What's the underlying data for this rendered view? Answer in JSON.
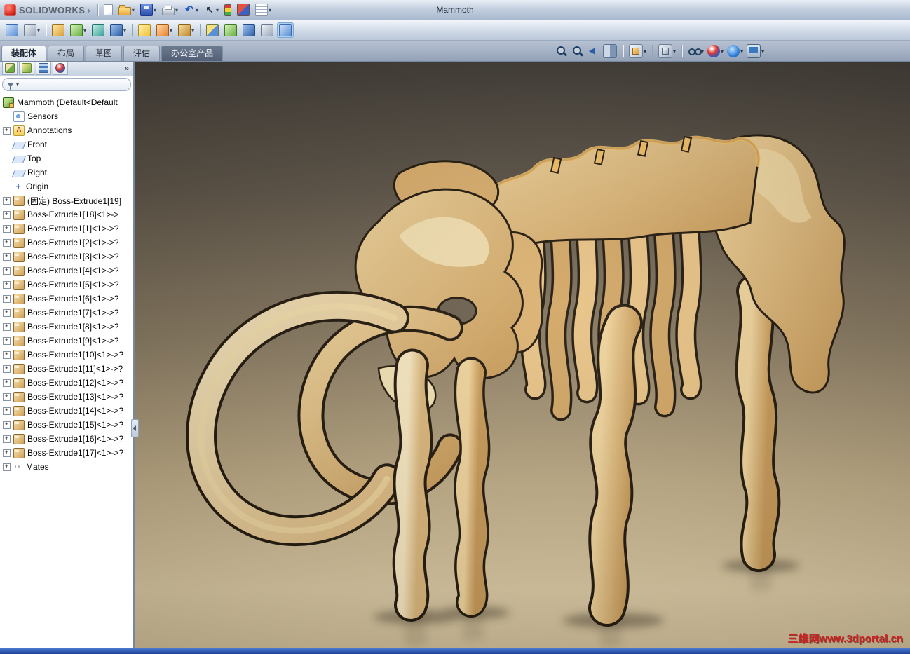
{
  "titlebar": {
    "app_name": "SOLIDWORKS",
    "title": "Mammoth",
    "menu_glyph": "›"
  },
  "toolbar_standard": {
    "items": [
      {
        "name": "new-document",
        "cls": "mi-new"
      },
      {
        "name": "open",
        "cls": "mi-open",
        "dd": true
      },
      {
        "name": "save",
        "cls": "mi-save",
        "dd": true
      },
      {
        "name": "print",
        "cls": "mi-print",
        "dd": true
      },
      {
        "name": "undo",
        "cls": "mi-undo",
        "glyph": "↶",
        "dd": true
      },
      {
        "name": "select",
        "cls": "mi-select",
        "glyph": "↖",
        "dd": true
      },
      {
        "name": "rebuild-stoplight",
        "cls": "mi-traffic"
      },
      {
        "name": "color-swatch",
        "cls": "mi-swatch"
      },
      {
        "name": "options",
        "cls": "mi-lines",
        "dd": true
      }
    ]
  },
  "toolbar_assembly": {
    "items": [
      {
        "name": "insert-components",
        "cls": "g-blue"
      },
      {
        "name": "mate",
        "cls": "g-gray",
        "dd": true
      },
      {
        "sep": true
      },
      {
        "name": "attachment",
        "cls": "g-gold"
      },
      {
        "name": "linear-component-pattern",
        "cls": "g-green",
        "dd": true
      },
      {
        "name": "smart-fasteners",
        "cls": "g-teal"
      },
      {
        "name": "move-component",
        "cls": "g-blue2",
        "dd": true
      },
      {
        "sep": true
      },
      {
        "name": "show-hidden-components",
        "cls": "g-yellow"
      },
      {
        "name": "assembly-features",
        "cls": "g-orange",
        "dd": true
      },
      {
        "name": "reference-geometry",
        "cls": "g-gold2",
        "dd": true
      },
      {
        "sep": true
      },
      {
        "name": "bill-of-materials",
        "cls": "g-mix"
      },
      {
        "name": "exploded-view",
        "cls": "g-green"
      },
      {
        "name": "explode-line-sketch",
        "cls": "g-blue2"
      },
      {
        "name": "interference-detection",
        "cls": "g-gray"
      },
      {
        "name": "large-assembly-mode",
        "cls": "g-blue",
        "pressed": true
      }
    ]
  },
  "tabs": {
    "items": [
      {
        "label": "装配体",
        "state": "active"
      },
      {
        "label": "布局",
        "state": "normal"
      },
      {
        "label": "草图",
        "state": "normal"
      },
      {
        "label": "评估",
        "state": "normal"
      },
      {
        "label": "办公室产品",
        "state": "dark"
      }
    ]
  },
  "headsup": {
    "items": [
      {
        "name": "zoom-to-fit",
        "cls": "hu-mag"
      },
      {
        "name": "zoom-to-area",
        "cls": "hu-mag2"
      },
      {
        "name": "previous-view",
        "cls": "hu-prev"
      },
      {
        "name": "section-view",
        "cls": "hu-sect"
      },
      {
        "sep": true
      },
      {
        "name": "view-orientation",
        "cls": "hu-cube",
        "dd": true
      },
      {
        "sep": true
      },
      {
        "name": "display-style",
        "cls": "hu-style",
        "dd": true
      },
      {
        "sep": true
      },
      {
        "name": "hide-show-items",
        "cls": "hu-eye",
        "dd": true
      },
      {
        "name": "edit-appearance",
        "cls": "hu-ball",
        "dd": true
      },
      {
        "name": "apply-scene",
        "cls": "hu-scene",
        "dd": true
      },
      {
        "name": "view-settings",
        "cls": "hu-view",
        "dd": true
      }
    ]
  },
  "feature_tree": {
    "panel_more_glyph": "»",
    "filter_caret": "▾",
    "items": [
      {
        "label": "Mammoth (Default<Default",
        "icon": "assembly",
        "root": true
      },
      {
        "label": "Sensors",
        "icon": "sensors"
      },
      {
        "label": "Annotations",
        "icon": "annotations",
        "expander": "+"
      },
      {
        "label": "Front",
        "icon": "plane"
      },
      {
        "label": "Top",
        "icon": "plane"
      },
      {
        "label": "Right",
        "icon": "plane"
      },
      {
        "label": "Origin",
        "icon": "origin"
      },
      {
        "label": "(固定) Boss-Extrude1[19]",
        "icon": "part",
        "expander": "+"
      },
      {
        "label": "Boss-Extrude1[18]<1>->",
        "icon": "part",
        "expander": "+"
      },
      {
        "label": "Boss-Extrude1[1]<1>->?",
        "icon": "part",
        "expander": "+"
      },
      {
        "label": "Boss-Extrude1[2]<1>->?",
        "icon": "part",
        "expander": "+"
      },
      {
        "label": "Boss-Extrude1[3]<1>->?",
        "icon": "part",
        "expander": "+"
      },
      {
        "label": "Boss-Extrude1[4]<1>->?",
        "icon": "part",
        "expander": "+"
      },
      {
        "label": "Boss-Extrude1[5]<1>->?",
        "icon": "part",
        "expander": "+"
      },
      {
        "label": "Boss-Extrude1[6]<1>->?",
        "icon": "part",
        "expander": "+"
      },
      {
        "label": "Boss-Extrude1[7]<1>->?",
        "icon": "part",
        "expander": "+"
      },
      {
        "label": "Boss-Extrude1[8]<1>->?",
        "icon": "part",
        "expander": "+"
      },
      {
        "label": "Boss-Extrude1[9]<1>->?",
        "icon": "part",
        "expander": "+"
      },
      {
        "label": "Boss-Extrude1[10]<1>->?",
        "icon": "part",
        "expander": "+"
      },
      {
        "label": "Boss-Extrude1[11]<1>->?",
        "icon": "part",
        "expander": "+"
      },
      {
        "label": "Boss-Extrude1[12]<1>->?",
        "icon": "part",
        "expander": "+"
      },
      {
        "label": "Boss-Extrude1[13]<1>->?",
        "icon": "part",
        "expander": "+"
      },
      {
        "label": "Boss-Extrude1[14]<1>->?",
        "icon": "part",
        "expander": "+"
      },
      {
        "label": "Boss-Extrude1[15]<1>->?",
        "icon": "part",
        "expander": "+"
      },
      {
        "label": "Boss-Extrude1[16]<1>->?",
        "icon": "part",
        "expander": "+"
      },
      {
        "label": "Boss-Extrude1[17]<1>->?",
        "icon": "part",
        "expander": "+"
      },
      {
        "label": "Mates",
        "icon": "mates",
        "expander": "+"
      }
    ]
  },
  "viewport": {
    "watermark": "三维网www.3dportal.cn"
  },
  "colors": {
    "wood_light": "#f0d49c",
    "wood_dark": "#c89a58",
    "edge_dark": "#241a0e",
    "watermark_red": "#cc2020",
    "statusbar_blue": "#1e3f96"
  }
}
